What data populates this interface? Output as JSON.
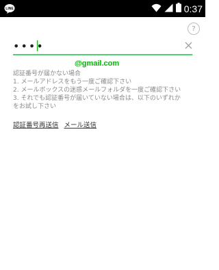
{
  "status_bar": {
    "time": "0:37",
    "icons": [
      "line-app-icon",
      "wifi-icon",
      "cellular-signal-icon",
      "battery-icon"
    ]
  },
  "help": {
    "label": "?"
  },
  "code_input": {
    "value": "••••",
    "clear_icon": "close-icon"
  },
  "email": {
    "text": "@gmail.com"
  },
  "hint": {
    "lines": [
      "認証番号が届かない場合",
      "1. メールアドレスをもう一度ご確認下さい",
      "2. メールボックスの迷惑メールフォルダを一度ご確認下さい",
      "3. それでも認証番号が届いていない場合は、以下のいずれか",
      "をお試し下さい"
    ]
  },
  "links": {
    "resend_code": "認証番号再送信",
    "send_email": "メール送信"
  },
  "colors": {
    "accent": "#00b900",
    "input_underline": "#4cd070",
    "hint_text": "#8a8a8a",
    "status_bar": "#000000"
  }
}
